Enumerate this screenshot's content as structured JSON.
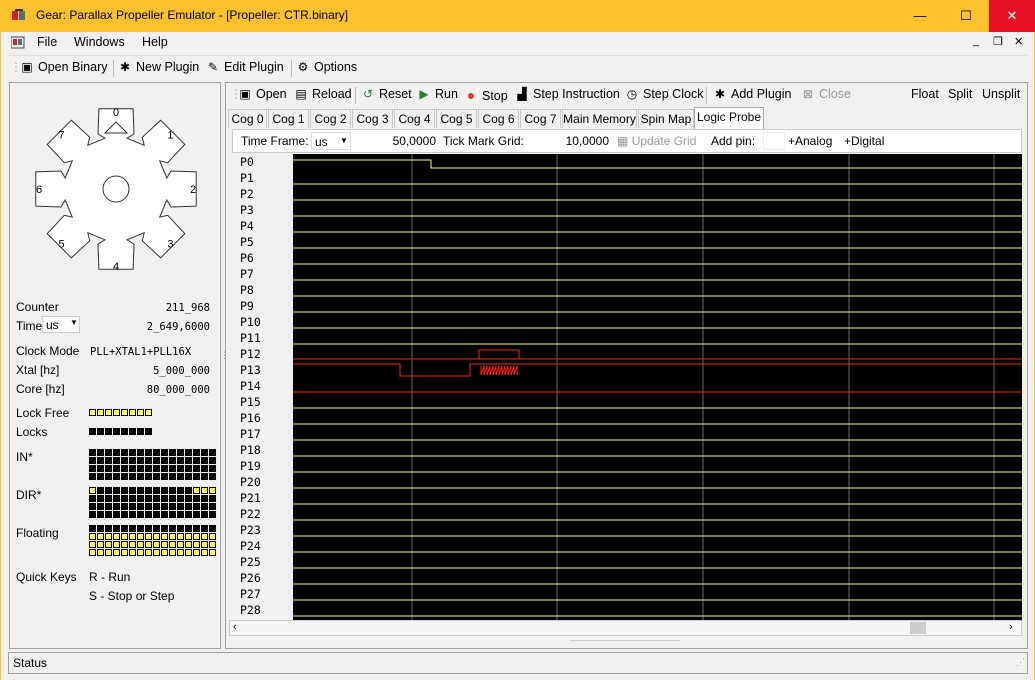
{
  "window": {
    "title": "Gear: Parallax Propeller Emulator - [Propeller: CTR.binary]",
    "minimize": "—",
    "maximize": "☐",
    "close": "✕"
  },
  "menu": {
    "file": "File",
    "windows": "Windows",
    "help": "Help"
  },
  "mdi": {
    "min": "_",
    "restore": "❐",
    "close": "✕"
  },
  "toolbar": {
    "open_binary": "Open Binary",
    "new_plugin": "New Plugin",
    "edit_plugin": "Edit Plugin",
    "options": "Options"
  },
  "hub": {
    "cog_labels": [
      "0",
      "1",
      "2",
      "3",
      "4",
      "5",
      "6",
      "7"
    ],
    "counter_label": "Counter",
    "counter_value": "211_968",
    "time_label": "Time",
    "time_unit": "us",
    "time_value": "2_649,6000",
    "clock_mode_label": "Clock Mode",
    "clock_mode_value": "PLL+XTAL1+PLL16X",
    "xtal_label": "Xtal [hz]",
    "xtal_value": "5_000_000",
    "core_label": "Core [hz]",
    "core_value": "80_000_000",
    "lock_free_label": "Lock Free",
    "locks_label": "Locks",
    "in_label": "IN*",
    "dir_label": "DIR*",
    "floating_label": "Floating",
    "quick_keys_label": "Quick Keys",
    "quick_key_run": "R - Run",
    "quick_key_stop": "S - Stop or Step",
    "lock_free": [
      1,
      1,
      1,
      1,
      1,
      1,
      1,
      1
    ],
    "locks": [
      0,
      0,
      0,
      0,
      0,
      0,
      0,
      0
    ],
    "in_bits": [
      [
        0,
        0,
        0,
        0,
        0,
        0,
        0,
        0,
        0,
        0,
        0,
        0,
        0,
        0,
        0,
        0
      ],
      [
        0,
        0,
        0,
        0,
        0,
        0,
        0,
        0,
        0,
        0,
        0,
        0,
        0,
        0,
        0,
        0
      ],
      [
        0,
        0,
        0,
        0,
        0,
        0,
        0,
        0,
        0,
        0,
        0,
        0,
        0,
        0,
        0,
        0
      ],
      [
        0,
        0,
        0,
        0,
        0,
        0,
        0,
        0,
        0,
        0,
        0,
        0,
        0,
        0,
        0,
        0
      ]
    ],
    "dir_bits": [
      [
        1,
        0,
        0,
        0,
        0,
        0,
        0,
        0,
        0,
        0,
        0,
        0,
        0,
        1,
        1,
        1
      ],
      [
        0,
        0,
        0,
        0,
        0,
        0,
        0,
        0,
        0,
        0,
        0,
        0,
        0,
        0,
        0,
        0
      ],
      [
        0,
        0,
        0,
        0,
        0,
        0,
        0,
        0,
        0,
        0,
        0,
        0,
        0,
        0,
        0,
        0
      ],
      [
        0,
        0,
        0,
        0,
        0,
        0,
        0,
        0,
        0,
        0,
        0,
        0,
        0,
        0,
        0,
        0
      ]
    ],
    "floating_bits": [
      [
        0,
        0,
        0,
        0,
        0,
        0,
        0,
        0,
        0,
        0,
        0,
        0,
        0,
        0,
        0,
        0
      ],
      [
        1,
        1,
        1,
        1,
        1,
        1,
        1,
        1,
        1,
        1,
        1,
        1,
        1,
        1,
        1,
        1
      ],
      [
        1,
        1,
        1,
        1,
        1,
        1,
        1,
        1,
        1,
        1,
        1,
        1,
        1,
        1,
        1,
        1
      ],
      [
        1,
        1,
        1,
        1,
        1,
        1,
        1,
        1,
        1,
        1,
        1,
        1,
        1,
        1,
        1,
        1
      ]
    ]
  },
  "toolbar2": {
    "open": "Open",
    "reload": "Reload",
    "reset": "Reset",
    "run": "Run",
    "stop": "Stop",
    "step_instruction": "Step Instruction",
    "step_clock": "Step Clock",
    "add_plugin": "Add Plugin",
    "close": "Close",
    "float": "Float",
    "split": "Split",
    "unsplit": "Unsplit"
  },
  "tabs": [
    "Cog 0",
    "Cog 1",
    "Cog 2",
    "Cog 3",
    "Cog 4",
    "Cog 5",
    "Cog 6",
    "Cog 7",
    "Main Memory",
    "Spin Map",
    "Logic Probe"
  ],
  "active_tab": "Logic Probe",
  "probe": {
    "time_frame_label": "Time Frame:",
    "time_frame_unit": "us",
    "time_frame_value": "50,0000",
    "tick_grid_label": "Tick Mark Grid:",
    "tick_grid_value": "10,0000",
    "update_grid": "Update Grid",
    "add_pin_label": "Add pin:",
    "add_analog": "+Analog",
    "add_digital": "+Digital",
    "pins": [
      "P0",
      "P1",
      "P2",
      "P3",
      "P4",
      "P5",
      "P6",
      "P7",
      "P8",
      "P9",
      "P10",
      "P11",
      "P12",
      "P13",
      "P14",
      "P15",
      "P16",
      "P17",
      "P18",
      "P19",
      "P20",
      "P21",
      "P22",
      "P23",
      "P24",
      "P25",
      "P26",
      "P27",
      "P28"
    ]
  },
  "colors": {
    "title_bar": "#fbc02d",
    "close_red": "#e81123",
    "trace_yellow": "#ffff66",
    "trace_red": "#ff2020",
    "grid_line": "#666666",
    "plot_bg": "#000000"
  },
  "status": "Status"
}
